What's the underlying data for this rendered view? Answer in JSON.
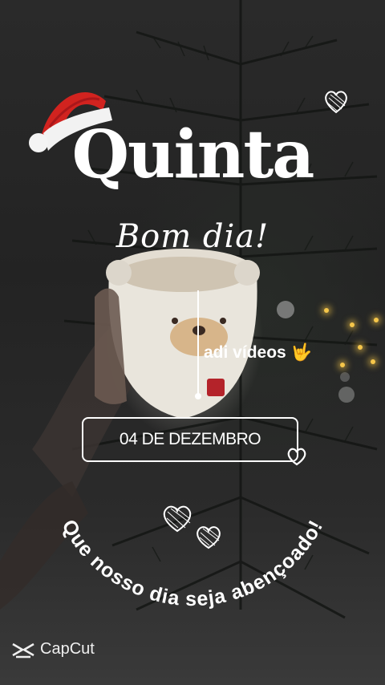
{
  "greeting": {
    "day": "Quinta",
    "hello": "Bom dia!"
  },
  "channel": {
    "name": "adi vídeos",
    "emoji": "🤟"
  },
  "date": {
    "text": "04 DE DEZEMBRO"
  },
  "blessing": {
    "text": "Que nosso dia seja abençoado!"
  },
  "watermark": {
    "label": "CapCut",
    "icon": "capcut-logo-icon"
  },
  "decor": {
    "hat_icon": "santa-hat-icon",
    "heart_icon": "heart-outline-icon",
    "accent": "#ffffff",
    "hat_red": "#d1231f"
  }
}
